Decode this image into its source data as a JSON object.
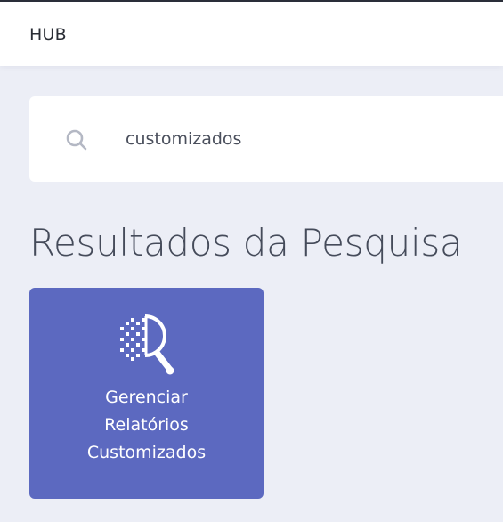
{
  "header": {
    "title": "HUB"
  },
  "search": {
    "icon": "search-icon",
    "value": "customizados"
  },
  "results": {
    "title": "Resultados da Pesquisa",
    "items": [
      {
        "icon": "search-pixels-icon",
        "label_lines": [
          "Gerenciar",
          "Relatórios",
          "Customizados"
        ]
      }
    ]
  },
  "colors": {
    "background": "#eceef6",
    "card": "#5c69c0",
    "header_bg": "#ffffff"
  }
}
